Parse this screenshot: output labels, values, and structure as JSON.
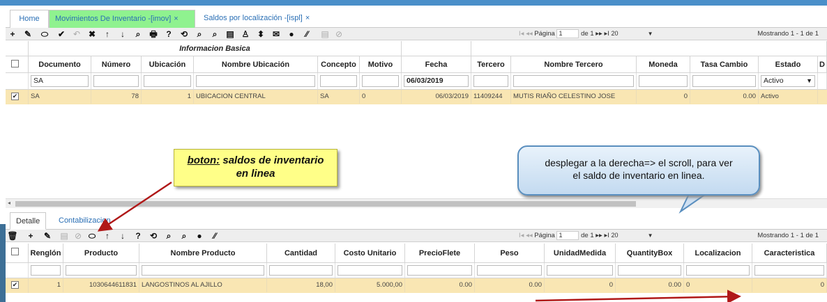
{
  "tabs": [
    {
      "label": "Home",
      "close": ""
    },
    {
      "label": "Movimientos De Inventario -[imov]",
      "close": "×"
    },
    {
      "label": "Saldos por localización -[ispl]",
      "close": "×"
    }
  ],
  "pager_top": {
    "first": "I◂",
    "prev": "◂◂",
    "pagina_label": "Página",
    "page": "1",
    "of": "de 1",
    "next": "▸▸",
    "last": "▸I",
    "size": "20",
    "size_arrow": "▼",
    "mostrando": "Mostrando 1 - 1 de 1"
  },
  "pager_bottom": {
    "first": "I◂",
    "prev": "◂◂",
    "pagina_label": "Página",
    "page": "1",
    "of": "de 1",
    "next": "▸▸",
    "last": "▸I",
    "size": "20",
    "size_arrow": "▼",
    "mostrando": "Mostrando 1 - 1 de 1"
  },
  "toolbar_top_icons": [
    "+",
    "✎",
    "⬭",
    "✔",
    "↶",
    "✖",
    "↑",
    "↓",
    "⌕",
    "🖶",
    "?",
    "⟲",
    "⌕",
    "⌕",
    "▤",
    "♙",
    "⬍",
    "✉",
    "●",
    "⁄⁄",
    "▤",
    "⊘"
  ],
  "toolbar_bottom_icons": [
    "🗑",
    "+",
    "✎",
    "▤",
    "⊘",
    "⬭",
    "↑",
    "↓",
    "?",
    "⟲",
    "⌕",
    "⌕",
    "●",
    "⁄⁄"
  ],
  "master": {
    "group_header": "Informacion Basica",
    "columns": [
      "Documento",
      "Número",
      "Ubicación",
      "Nombre Ubicación",
      "Concepto",
      "Motivo",
      "Fecha",
      "Tercero",
      "Nombre Tercero",
      "Moneda",
      "Tasa Cambio",
      "Estado",
      "D"
    ],
    "filters": {
      "documento": "SA",
      "fecha": "06/03/2019",
      "estado": "Activo",
      "estado_arrow": "▼"
    },
    "row": {
      "check": "✔",
      "documento": "SA",
      "numero": "78",
      "ubicacion": "1",
      "nombre_ubicacion": "UBICACION CENTRAL",
      "concepto": "SA",
      "motivo": "0",
      "fecha": "06/03/2019",
      "tercero": "11409244",
      "nombre_tercero": "MUTIS RIAÑO CELESTINO JOSE",
      "moneda": "0",
      "tasa_cambio": "0.00",
      "estado": "Activo"
    }
  },
  "detail_tabs": [
    "Detalle",
    "Contabilizacion"
  ],
  "detail": {
    "columns": [
      "Renglón",
      "Producto",
      "Nombre Producto",
      "Cantidad",
      "Costo Unitario",
      "PrecioFlete",
      "Peso",
      "UnidadMedida",
      "QuantityBox",
      "Localizacion",
      "Caracteristica"
    ],
    "row": {
      "check": "✔",
      "renglon": "1",
      "producto": "1030644611831",
      "nombre_producto": "LANGOSTINOS AL AJILLO",
      "cantidad": "18,00",
      "costo_unitario": "5.000,00",
      "precio_flete": "0.00",
      "peso": "0.00",
      "unidad_medida": "0",
      "quantity_box": "0.00",
      "localizacion": "0",
      "caracteristica": "0"
    }
  },
  "callouts": {
    "boton_prefix": "boton:",
    "boton_rest": " saldos de inventario",
    "boton_line2": "en linea",
    "scroll_line1": "desplegar a la derecha=> el scroll, para ver",
    "scroll_line2": "el saldo de inventario en linea."
  },
  "colors": {
    "active_tab": "#8ff28f",
    "selected_row": "#f9e6b3",
    "arrow": "#b01818",
    "callout_yellow": "#ffff88",
    "top_strip": "#4a8fc9"
  }
}
